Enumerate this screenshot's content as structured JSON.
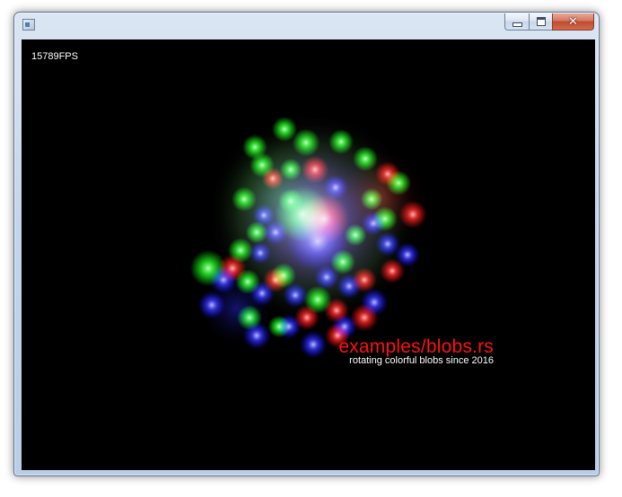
{
  "window": {
    "title": "",
    "icon": "app-window-icon",
    "caption_buttons": {
      "minimize_icon": "minimize-icon",
      "maximize_icon": "maximize-icon",
      "close_glyph": "✕"
    }
  },
  "canvas": {
    "background": "#000000",
    "fps": "15789FPS",
    "title": "examples/blobs.rs",
    "subtitle": "rotating colorful blobs since 2016",
    "title_color": "#ff1111",
    "blob_colors": [
      "#00ff00",
      "#ff0000",
      "#0000ff"
    ]
  }
}
